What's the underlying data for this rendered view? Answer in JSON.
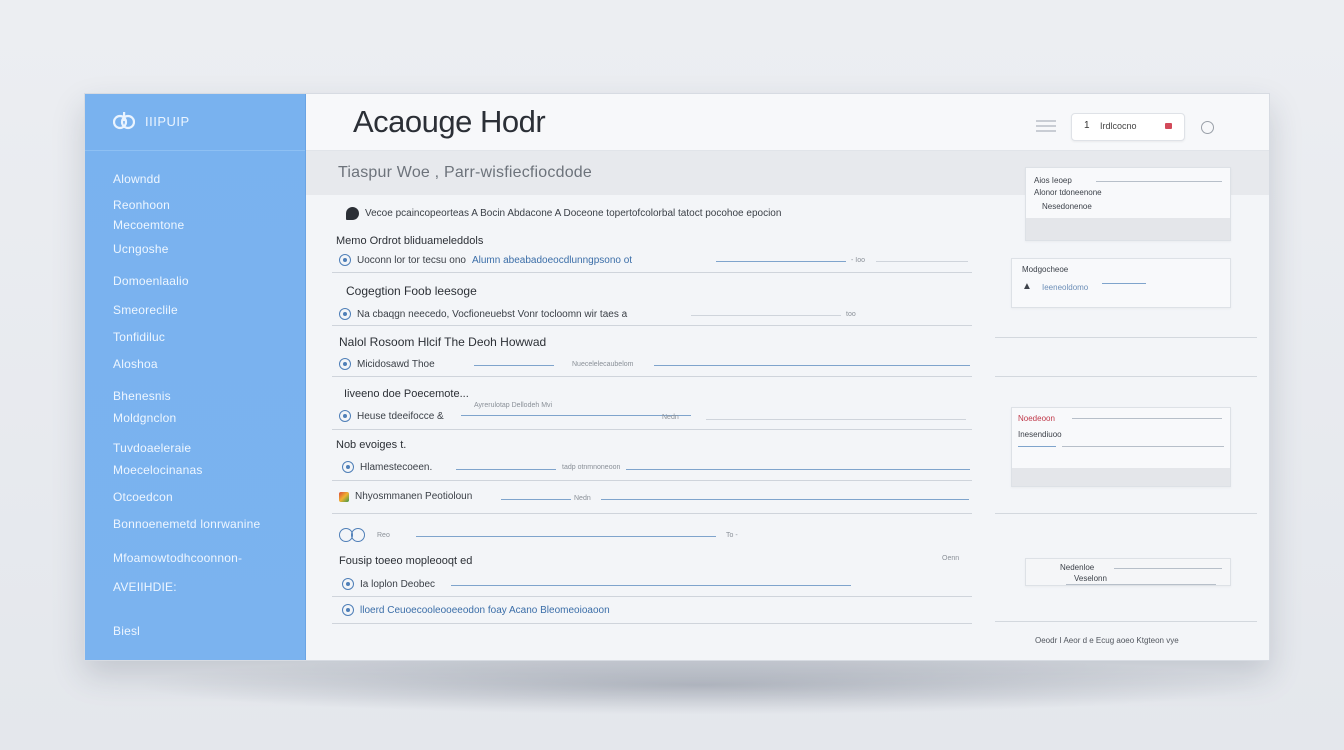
{
  "app": {
    "logo_text": "IIIPUIP",
    "title": "Acaouge Hodr",
    "header_pill_mark": "1",
    "header_pill_text": "Irdlcocno",
    "subtitle": "Tiaspur Woe ,  Parr-wisfiecfiocdode"
  },
  "sidebar": {
    "items": [
      "Alowndd",
      "Reonhoon",
      "Mecoemtone",
      "Ucngoshe",
      "Domoenlaalio",
      "Smeoreclile",
      "Tonfidiluc",
      "Aloshoa",
      "Bhenesnis",
      "Moldgnclon",
      "Tuvdoaeleraie",
      "Moecelocinanas",
      "Otcoedcon",
      "Bonnoenemetd lonrwanine",
      "Mfoamowtodhcoonnon-",
      "AVEIIHDIE:",
      "Biesl"
    ]
  },
  "main": {
    "intro": "Vecoe pcaincopeorteas A Bocin Abdacone A Doceone topertofcolorbal tatoct pocohoe epocion",
    "sections": [
      {
        "heading": "Memo Ordrot bliduameleddols",
        "item_black": "Uoconn lor tor tecsu ono",
        "item_blue": "Alumn abeabadoeocdlunngpsono ot",
        "tail": "- Ioo"
      },
      {
        "heading": "Cogegtion Foob leesoge",
        "item": "Na cbaqgn neecedo, Vocfioneuebst Vonr tocloomn wir taes a",
        "tail": "too"
      },
      {
        "heading": "Nalol Rosoom Hlcif The Deoh Howwad",
        "item": "Micidosawd Thoe",
        "item_blue": "Nuecelelecaubelom"
      },
      {
        "heading": "Iiveeno doe Poecemote...",
        "item": "Heuse tdeeifocce &",
        "item_blue": "Ayrerulotap Dellodeh Mvi",
        "tail": "Nedn"
      },
      {
        "heading": "Nob evoiges t.",
        "item": "Hlamestecoeen.",
        "item_small": "tadp otnmnoneoon"
      },
      {
        "item": "Nhyosmmanen Peotioloun",
        "item_small": "Nedn"
      },
      {
        "item_small": "Reo",
        "tail": "To -"
      },
      {
        "heading": "Fousip toeeo mopleooqt ed",
        "item": "Ia loplon Deobec",
        "tail": "Oenn"
      },
      {
        "item_blue": "lloerd Ceuoecooleooeeodon foay Acano Bleomeoioaoon"
      }
    ]
  },
  "right_panel": {
    "card1": {
      "title": "Aios   Ieoep",
      "line1": "Alonor tdoneenone",
      "line2": "Nesedonenoe"
    },
    "card2": {
      "title": "Modgocheoe",
      "line1": "Ieeneoldomo"
    },
    "card3": {
      "title": "Noedeoon",
      "line1": "Inesendiuoo"
    },
    "card4": {
      "title": "Nedenloe",
      "line1": "Veselonn"
    },
    "footer": "Oeodr I Aeor d e Ecug aoeo Ktgteon vye"
  },
  "colors": {
    "sidebar": "#79b2ef",
    "accent_blue": "#3b6ea8",
    "badge_red": "#d24a5a"
  }
}
